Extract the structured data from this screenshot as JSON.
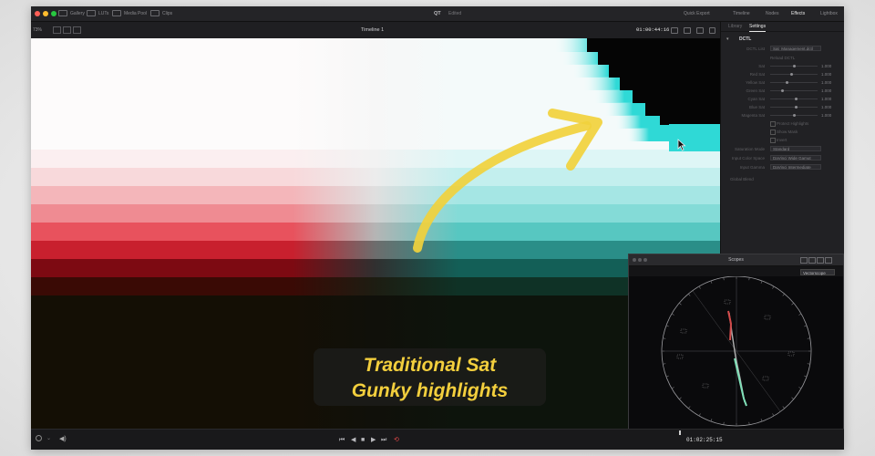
{
  "topbar": {
    "nav_items": [
      {
        "label": "Gallery",
        "icon": "gallery-icon"
      },
      {
        "label": "LUTs",
        "icon": "luts-icon"
      },
      {
        "label": "Media Pool",
        "icon": "media-pool-icon"
      },
      {
        "label": "Clips",
        "icon": "clips-icon"
      }
    ],
    "project_title": "QT",
    "project_subtitle": "Edited",
    "right_items": [
      {
        "label": "Quick Export",
        "active": false
      },
      {
        "label": "Timeline",
        "active": false
      },
      {
        "label": "Nodes",
        "active": false
      },
      {
        "label": "Effects",
        "active": true
      },
      {
        "label": "Lightbox",
        "active": false
      }
    ]
  },
  "subbar": {
    "zoom": "73%",
    "timeline_name": "Timeline 1",
    "timecode": "01:00:44:16"
  },
  "viewer": {
    "caption_line1": "Traditional Sat",
    "caption_line2": "Gunky highlights",
    "arrow_color": "#f1d13c",
    "highlight_color": "#2fd9d6"
  },
  "inspector": {
    "tabs": [
      "Library",
      "Settings"
    ],
    "active_tab": "Settings",
    "effect_title": "DCTL",
    "dctl_list_label": "DCTL List",
    "dctl_list_value": "Sat_Management.dctl",
    "reload_label": "Reload DCTL",
    "sliders": [
      {
        "label": "Sat",
        "value": "1.000",
        "level": 0.5
      },
      {
        "label": "Red Sat",
        "value": "1.000",
        "level": 0.45
      },
      {
        "label": "Yellow Sat",
        "value": "1.000",
        "level": 0.35
      },
      {
        "label": "Green Sat",
        "value": "1.000",
        "level": 0.25
      },
      {
        "label": "Cyan Sat",
        "value": "1.000",
        "level": 0.55
      },
      {
        "label": "Blue Sat",
        "value": "1.000",
        "level": 0.55
      },
      {
        "label": "Magenta Sat",
        "value": "1.000",
        "level": 0.5
      }
    ],
    "checkboxes": [
      "Protect Highlights",
      "Show Mask",
      "Invert"
    ],
    "dropdowns": [
      {
        "label": "Saturation Mode",
        "value": "Standard"
      },
      {
        "label": "Input Color Space",
        "value": "DaVinci Wide Gamut"
      },
      {
        "label": "Input Gamma",
        "value": "DaVinci Intermediate"
      }
    ],
    "global_blend": "Global Blend"
  },
  "scopes": {
    "title": "Scopes",
    "mode": "Vectorscope",
    "trace_color": "#7fe0b8",
    "trace_red": "#d24a4a"
  },
  "bottombar": {
    "timecode": "01:02:25:15"
  }
}
